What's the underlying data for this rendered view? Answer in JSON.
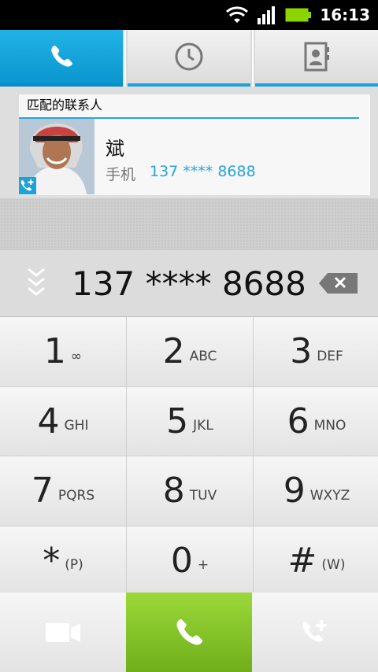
{
  "status_bar": {
    "time": "16:13",
    "icons": [
      "wifi-icon",
      "signal-icon",
      "battery-icon"
    ]
  },
  "tabs": [
    {
      "name": "dialer",
      "icon": "phone-icon",
      "active": true
    },
    {
      "name": "recents",
      "icon": "clock-icon",
      "active": false
    },
    {
      "name": "contacts",
      "icon": "contacts-book-icon",
      "active": false
    }
  ],
  "matched": {
    "header": "匹配的联系人",
    "contact": {
      "name": "斌",
      "phone_type": "手机",
      "phone_number": "137 **** 8688"
    }
  },
  "dialer": {
    "number_display": "137 **** 8688"
  },
  "keypad": [
    {
      "digit": "1",
      "letters": "∞"
    },
    {
      "digit": "2",
      "letters": "ABC"
    },
    {
      "digit": "3",
      "letters": "DEF"
    },
    {
      "digit": "4",
      "letters": "GHI"
    },
    {
      "digit": "5",
      "letters": "JKL"
    },
    {
      "digit": "6",
      "letters": "MNO"
    },
    {
      "digit": "7",
      "letters": "PQRS"
    },
    {
      "digit": "8",
      "letters": "TUV"
    },
    {
      "digit": "9",
      "letters": "WXYZ"
    },
    {
      "digit": "*",
      "letters": "(P)"
    },
    {
      "digit": "0",
      "letters": "+"
    },
    {
      "digit": "#",
      "letters": "(W)"
    }
  ],
  "actions": [
    {
      "name": "video-call",
      "icon": "video-camera-icon"
    },
    {
      "name": "call",
      "icon": "phone-icon"
    },
    {
      "name": "add-call",
      "icon": "phone-plus-icon"
    }
  ],
  "colors": {
    "accent": "#1fa3d7",
    "call_green": "#7dbb1f"
  }
}
